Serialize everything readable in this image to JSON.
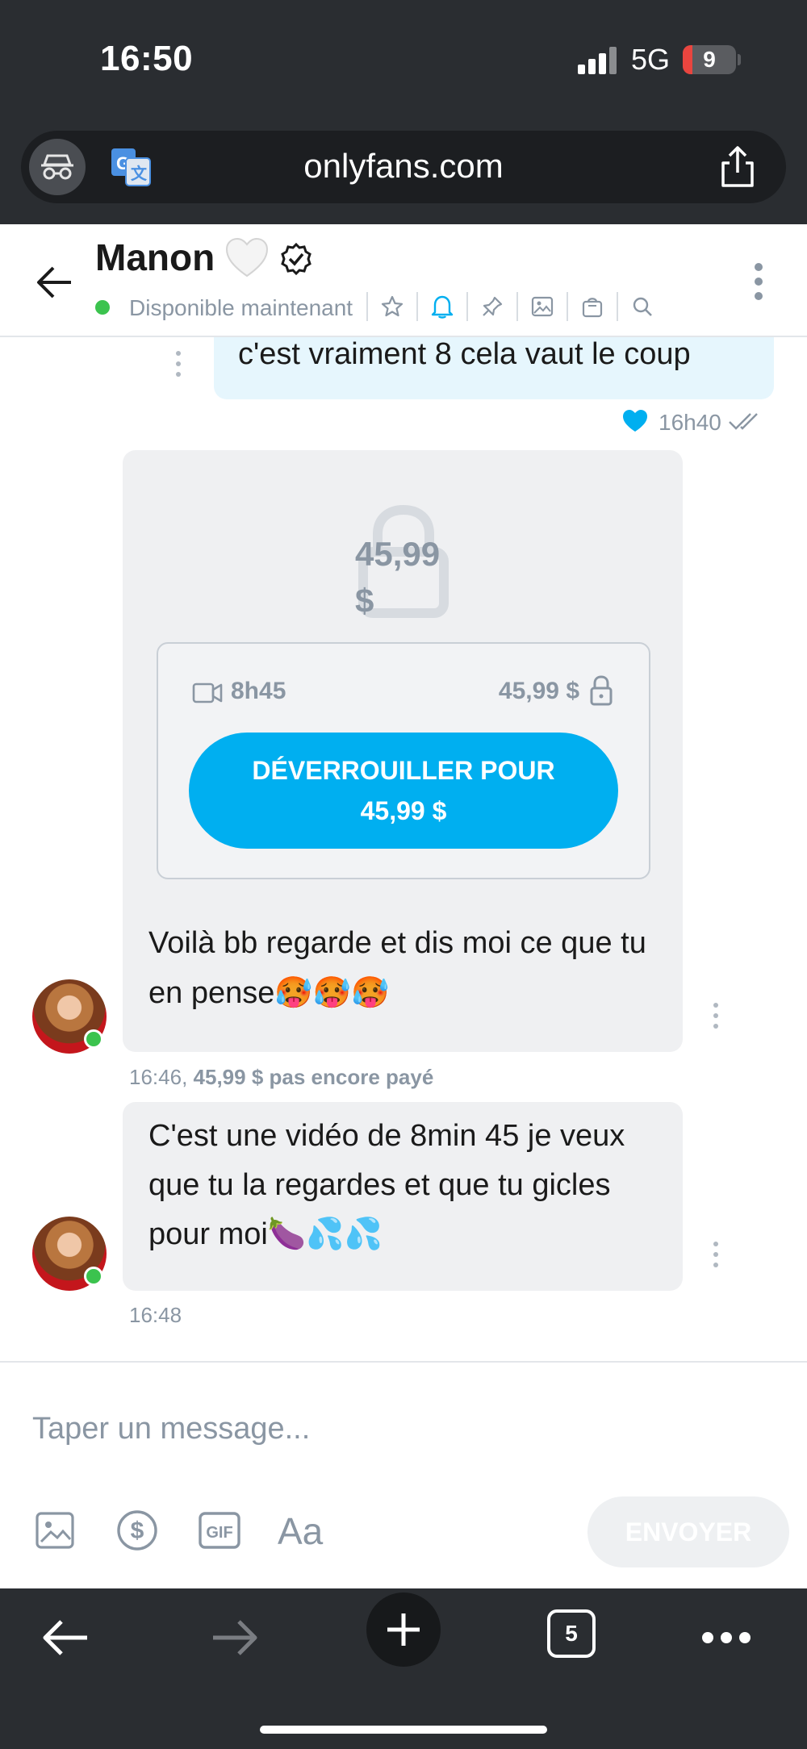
{
  "status_bar": {
    "time": "16:50",
    "network": "5G",
    "battery": "9"
  },
  "browser": {
    "url": "onlyfans.com",
    "open_tabs": "5"
  },
  "header": {
    "name": "Manon",
    "status": "Disponible maintenant",
    "icons": [
      "star-icon",
      "bell-icon",
      "pin-icon",
      "image-icon",
      "bag-icon",
      "search-icon"
    ]
  },
  "messages": {
    "sent": {
      "text": "c'est vraiment 8 cela vaut le coup",
      "time": "16h40"
    },
    "ppv": {
      "price_big": "45,99 $",
      "duration": "8h45",
      "price": "45,99 $",
      "unlock_line1": "DÉVERROUILLER POUR",
      "unlock_line2": "45,99 $",
      "text": "Voilà bb regarde et dis moi ce que tu en pense🥵🥵🥵",
      "meta_time": "16:46,",
      "meta_status": "45,99 $ pas encore payé"
    },
    "received2": {
      "text": "C'est une vidéo de 8min 45 je veux que tu la regardes et que tu gicles pour moi🍆💦💦",
      "time": "16:48"
    }
  },
  "composer": {
    "placeholder": "Taper un message...",
    "format_label": "Aa",
    "send_label": "ENVOYER"
  },
  "colors": {
    "accent": "#00aff0",
    "online": "#3bc34e",
    "muted": "#8a96a3",
    "sent_bubble": "#e6f6fd",
    "received_bubble": "#eff0f2"
  }
}
